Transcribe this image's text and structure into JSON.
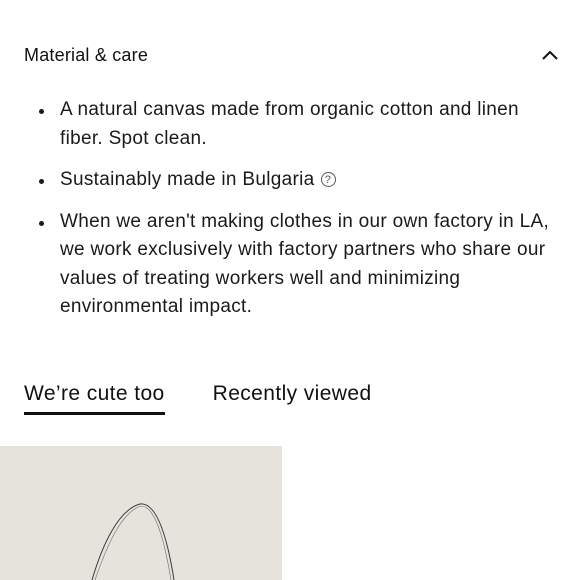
{
  "accordion": {
    "title": "Material & care",
    "icon": "chevron-up-icon"
  },
  "care_items": [
    {
      "text": "A natural canvas made from organic cotton and linen fiber. Spot clean."
    },
    {
      "text": "Sustainably made in Bulgaria",
      "icon": "question-circle-icon"
    },
    {
      "text": "When we aren't making clothes in our own factory in LA, we work exclusively with factory partners who share our values of treating workers well and minimizing environmental impact."
    }
  ],
  "tabs": [
    {
      "label": "We’re cute too",
      "active": true
    },
    {
      "label": "Recently viewed",
      "active": false
    }
  ],
  "colors": {
    "text": "#1a1a1a",
    "image_background": "#e6e3dc"
  }
}
